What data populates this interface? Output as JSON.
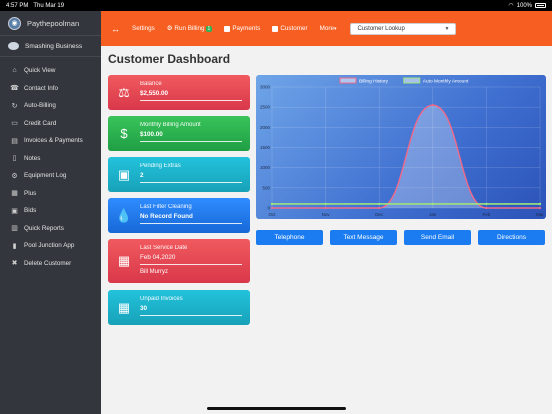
{
  "status": {
    "time": "4:57 PM",
    "date": "Thu Mar 19",
    "battery": "100%"
  },
  "sidebar": {
    "brand": "Paythepoolman",
    "business": "Smashing Business",
    "items": [
      {
        "label": "Quick View",
        "icon": "home-icon"
      },
      {
        "label": "Contact Info",
        "icon": "contact-icon"
      },
      {
        "label": "Auto-Billing",
        "icon": "auto-billing-icon"
      },
      {
        "label": "Credit Card",
        "icon": "credit-card-icon"
      },
      {
        "label": "Invoices & Payments",
        "icon": "invoices-icon"
      },
      {
        "label": "Notes",
        "icon": "notes-icon"
      },
      {
        "label": "Equipment Log",
        "icon": "equipment-icon"
      },
      {
        "label": "Plus",
        "icon": "plus-icon"
      },
      {
        "label": "Bids",
        "icon": "bids-icon"
      },
      {
        "label": "Quick Reports",
        "icon": "reports-icon"
      },
      {
        "label": "Pool Junction App",
        "icon": "mobile-icon"
      },
      {
        "label": "Delete Customer",
        "icon": "delete-user-icon"
      }
    ]
  },
  "topbar": {
    "settings": "Settings",
    "run_billing": "Run Billing",
    "run_billing_badge": "1",
    "payments": "Payments",
    "customer": "Customer",
    "more": "More",
    "lookup_value": "Customer Lookup"
  },
  "page": {
    "title": "Customer Dashboard"
  },
  "cards": {
    "balance": {
      "label": "Balance",
      "value": "$2,550.00"
    },
    "monthly": {
      "label": "Monthly Billing Amount",
      "value": "$100.00"
    },
    "pending": {
      "label": "Pending Extras",
      "value": "2"
    },
    "filter": {
      "label": "Last Filter Cleaning",
      "value": "No Record Found"
    },
    "service": {
      "label": "Last Service Date",
      "value": "Feb 04,2020",
      "extra": "Bill Murryz"
    },
    "unpaid": {
      "label": "Unpaid Invoices",
      "value": "30"
    }
  },
  "actions": {
    "telephone": "Telephone",
    "text": "Text Message",
    "email": "Send Email",
    "directions": "Directions"
  },
  "colors": {
    "accent": "#f75f22",
    "sidebar": "#33373d",
    "action": "#1a7cf0"
  },
  "chart_data": {
    "type": "line",
    "x": [
      "Oct",
      "Nov",
      "Dec",
      "Jan",
      "Feb",
      "Mar"
    ],
    "ylim": [
      0,
      3000
    ],
    "yticks": [
      0,
      500,
      1000,
      1500,
      2000,
      2500,
      3000
    ],
    "legend_position": "top",
    "series": [
      {
        "name": "Billing History",
        "values": [
          0,
          0,
          0,
          2550,
          0,
          0
        ],
        "color": "#f06a8a"
      },
      {
        "name": "Auto Monthly Amount",
        "values": [
          100,
          100,
          100,
          100,
          100,
          100
        ],
        "color": "#9ee37d"
      }
    ]
  }
}
